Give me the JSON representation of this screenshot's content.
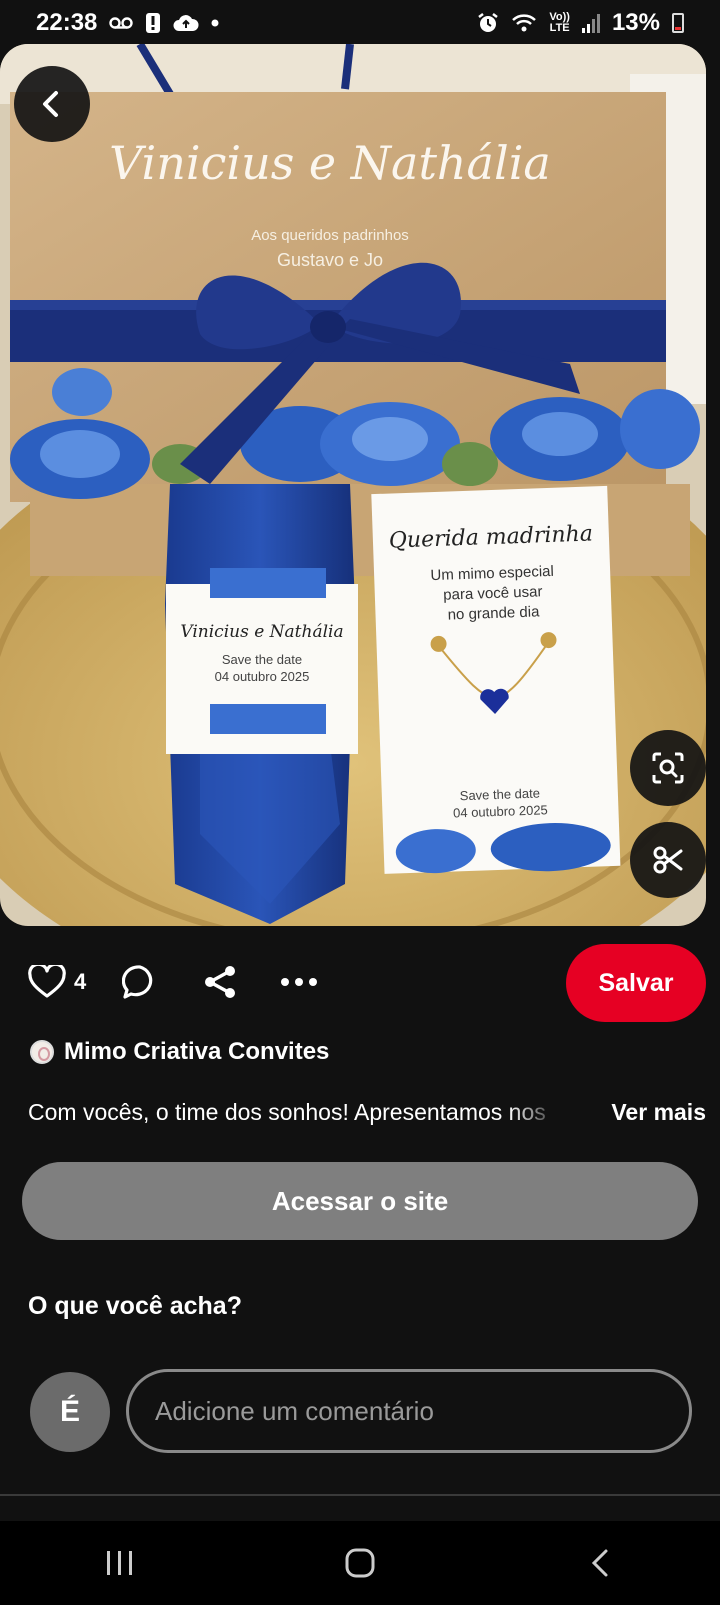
{
  "status_bar": {
    "time": "22:38",
    "battery_percent": "13%",
    "network_label": "LTE",
    "volte_label": "Vo))",
    "left_icons": [
      "voicemail-icon",
      "alert-icon",
      "cloud-upload-icon",
      "dot-icon"
    ],
    "right_icons": [
      "alarm-icon",
      "wifi-icon",
      "volte-icon",
      "signal-icon",
      "battery-icon"
    ]
  },
  "pin": {
    "image_texts": {
      "box_names": "Vinicius e Nathália",
      "box_subtitle": "Aos queridos padrinhos",
      "box_guests": "Gustavo e Jo",
      "tie_names": "Vinicius e Nathália",
      "tie_save_the_date": "Save the date",
      "tie_date": "04 outubro 2025",
      "card_title": "Querida madrinha",
      "card_line1": "Um mimo especial",
      "card_line2": "para você usar",
      "card_line3": "no grande dia",
      "card_save_the_date": "Save the date",
      "card_date": "04 outubro 2025"
    }
  },
  "actions": {
    "like_count": "4",
    "save_label": "Salvar"
  },
  "creator": {
    "name": "Mimo Criativa Convites"
  },
  "description": {
    "text": "Com vocês, o time dos sonhos! Apresentamos nos",
    "more_label": "Ver mais"
  },
  "visit_site_label": "Acessar o site",
  "feedback": {
    "title": "O que você acha?",
    "avatar_initial": "É",
    "comment_placeholder": "Adicione um comentário"
  },
  "colors": {
    "background": "#111111",
    "save_red": "#e60023",
    "visit_gray": "#7f7f7f",
    "ribbon_blue": "#1b2f7a",
    "kraft": "#c9a77a"
  }
}
